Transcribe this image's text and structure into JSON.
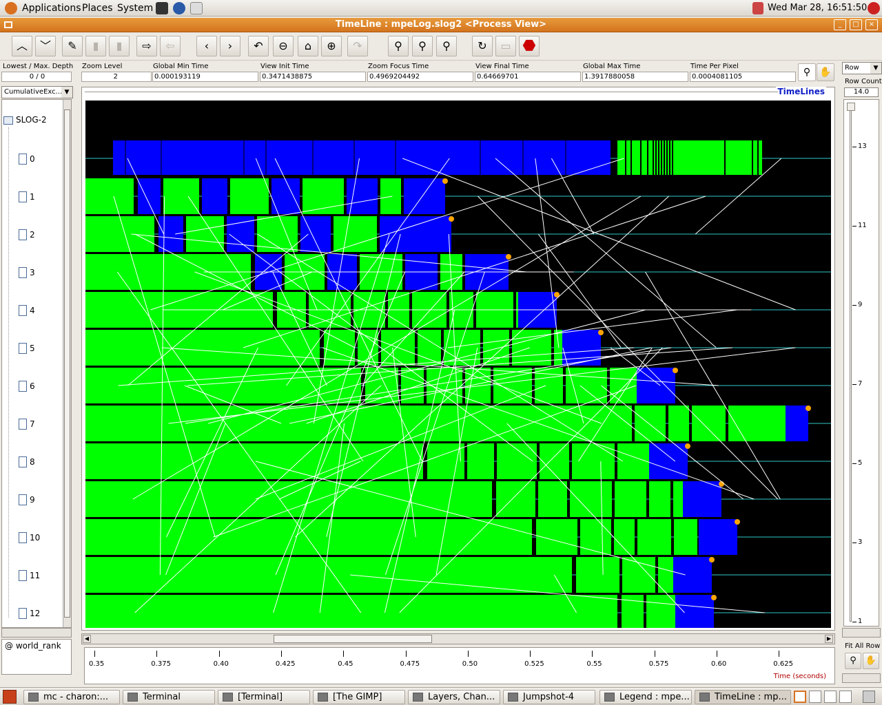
{
  "top_panel": {
    "menus": [
      "Applications",
      "Places",
      "System"
    ],
    "clock": "Wed Mar 28, 16:51:50"
  },
  "window": {
    "title": "TimeLine : mpeLog.slog2  <Process View>"
  },
  "toolbar": {
    "buttons": [
      "up-icon",
      "down-icon",
      "edit-icon",
      "clipboard-icon",
      "trash-icon",
      "export-icon",
      "import-icon",
      "back-icon",
      "forward-icon",
      "undo-icon",
      "zoom-out-icon",
      "home-icon",
      "zoom-in-icon",
      "redo-icon",
      "search-backward-icon",
      "search-icon",
      "search-forward-icon",
      "refresh-icon",
      "print-icon",
      "stop-icon"
    ]
  },
  "info": {
    "lowest_max_depth": {
      "label": "Lowest / Max. Depth",
      "value": "0 / 0"
    },
    "zoom_level": {
      "label": "Zoom Level",
      "value": "2"
    },
    "global_min": {
      "label": "Global Min Time",
      "value": "0.000193119"
    },
    "view_init": {
      "label": "View  Init Time",
      "value": "0.3471438875"
    },
    "zoom_focus": {
      "label": "Zoom Focus Time",
      "value": "0.4969204492"
    },
    "view_final": {
      "label": "View Final Time",
      "value": "0.64669701"
    },
    "global_max": {
      "label": "Global Max Time",
      "value": "1.3917880058"
    },
    "time_per_pixel": {
      "label": "Time Per Pixel",
      "value": "0.0004081105"
    }
  },
  "left": {
    "combo": "CumulativeExc...",
    "root": "SLOG-2",
    "rows": [
      "0",
      "1",
      "2",
      "3",
      "4",
      "5",
      "6",
      "7",
      "8",
      "9",
      "10",
      "11",
      "12"
    ],
    "footer": "@ world_rank"
  },
  "plot": {
    "title": "TimeLines"
  },
  "axis": {
    "ticks": [
      "0.35",
      "0.375",
      "0.40",
      "0.425",
      "0.45",
      "0.475",
      "0.50",
      "0.525",
      "0.55",
      "0.575",
      "0.60",
      "0.625"
    ],
    "label": "Time (seconds)"
  },
  "right": {
    "combo": "Row",
    "row_count_label": "Row Count",
    "row_count": "14.0",
    "scale": [
      "13",
      "11",
      "9",
      "7",
      "5",
      "3",
      "1"
    ],
    "fit": "Fit All Row"
  },
  "taskbar": [
    "mc - charon:...",
    "Terminal",
    "[Terminal]",
    "[The GIMP]",
    "Layers, Chan...",
    "Jumpshot-4",
    "Legend : mpe...",
    "TimeLine : mp..."
  ],
  "colors": {
    "compute": "#00ff00",
    "mpi": "#0000ff",
    "title_bar": "#d97d22",
    "arrows": "#ffffff",
    "marker": "#ffa500"
  }
}
